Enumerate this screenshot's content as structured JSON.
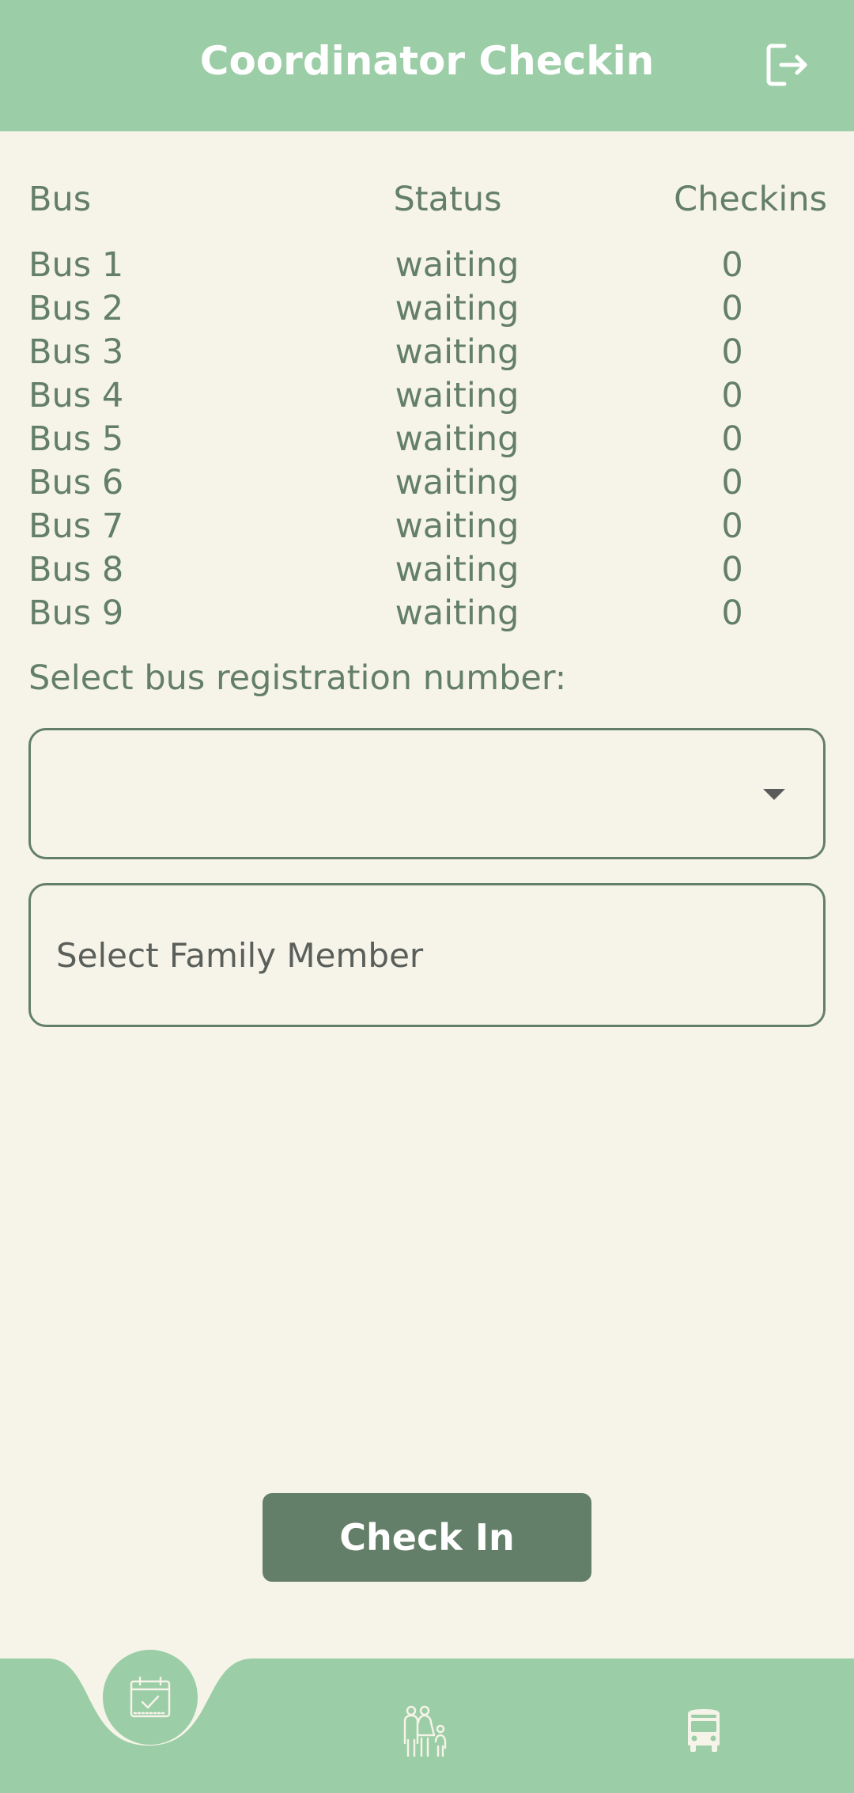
{
  "header": {
    "title": "Coordinator Checkin",
    "logout_icon": "logout-icon"
  },
  "table": {
    "headers": {
      "bus": "Bus",
      "status": "Status",
      "checkins": "Checkins"
    },
    "rows": [
      {
        "bus": "Bus 1",
        "status": "waiting",
        "checkins": "0"
      },
      {
        "bus": "Bus 2",
        "status": "waiting",
        "checkins": "0"
      },
      {
        "bus": "Bus 3",
        "status": "waiting",
        "checkins": "0"
      },
      {
        "bus": "Bus 4",
        "status": "waiting",
        "checkins": "0"
      },
      {
        "bus": "Bus 5",
        "status": "waiting",
        "checkins": "0"
      },
      {
        "bus": "Bus 6",
        "status": "waiting",
        "checkins": "0"
      },
      {
        "bus": "Bus 7",
        "status": "waiting",
        "checkins": "0"
      },
      {
        "bus": "Bus 8",
        "status": "waiting",
        "checkins": "0"
      },
      {
        "bus": "Bus 9",
        "status": "waiting",
        "checkins": "0"
      }
    ]
  },
  "form": {
    "bus_select_label": "Select bus registration number:",
    "bus_select_value": "",
    "family_placeholder": "Select Family Member",
    "checkin_label": "Check In"
  },
  "nav": {
    "items": [
      {
        "icon": "calendar-check-icon",
        "active": true
      },
      {
        "icon": "family-icon",
        "active": false
      },
      {
        "icon": "bus-icon",
        "active": false
      }
    ]
  },
  "colors": {
    "header_bg": "#9bcda6",
    "page_bg": "#f6f4e9",
    "text": "#647f69",
    "button_bg": "#647f69"
  }
}
